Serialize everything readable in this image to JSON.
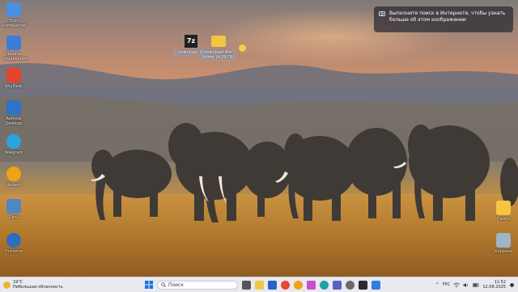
{
  "desktop": {
    "left_icons": [
      {
        "label": "Этот компьютер",
        "icon": "monitor-icon",
        "color": "#4a8fe0"
      },
      {
        "label": "Панель управления",
        "icon": "control-panel-icon",
        "color": "#3b7dd8"
      },
      {
        "label": "AnyDesk",
        "icon": "anydesk-icon",
        "color": "#e5432b"
      },
      {
        "label": "Remote Desktop",
        "icon": "remote-desktop-icon",
        "color": "#2c73c9"
      },
      {
        "label": "Telegram",
        "icon": "telegram-icon",
        "color": "#2aa3e0"
      },
      {
        "label": "Яндекс",
        "icon": "yandex-icon",
        "color": "#f0a219"
      },
      {
        "label": "Сеть",
        "icon": "network-icon",
        "color": "#4f86c6"
      },
      {
        "label": "Утилита",
        "icon": "utility-icon",
        "color": "#2d6cc0"
      }
    ],
    "right_icons": [
      {
        "label": "Папка",
        "icon": "folder-icon",
        "color": "#f3c543"
      },
      {
        "label": "Корзина",
        "icon": "recycle-bin-icon",
        "color": "#9fb4c8"
      }
    ],
    "center_icons": [
      {
        "label": "download.7z",
        "icon": "7zip-icon",
        "color": "#222222"
      },
      {
        "label": "download-file-folder (4.09 ГБ)",
        "icon": "folder-icon",
        "color": "#f3c543"
      }
    ]
  },
  "notification": {
    "text": "Выполните поиск в Интернете, чтобы узнать больше об этом изображении"
  },
  "taskbar": {
    "weather_temp": "19°C",
    "weather_desc": "Небольшая облачность",
    "search_placeholder": "Поиск",
    "language": "РУС",
    "time": "11:52",
    "date": "12.08.2025",
    "pinned": [
      {
        "icon": "windows-start-icon",
        "color": "#1a73e8"
      },
      {
        "icon": "task-view-icon",
        "color": "#555555"
      },
      {
        "icon": "file-explorer-icon",
        "color": "#f3c543"
      },
      {
        "icon": "store-icon",
        "color": "#2b63c4"
      },
      {
        "icon": "chrome-icon",
        "color": "#e9453a"
      },
      {
        "icon": "yandex-browser-icon",
        "color": "#f0a219"
      },
      {
        "icon": "photos-icon",
        "color": "#c94fcf"
      },
      {
        "icon": "edge-icon",
        "color": "#1fa0a7"
      },
      {
        "icon": "teams-icon",
        "color": "#5a5fc7"
      },
      {
        "icon": "settings-icon",
        "color": "#6b6b6b"
      },
      {
        "icon": "terminal-icon",
        "color": "#2a2a2a"
      },
      {
        "icon": "mail-icon",
        "color": "#2f7fe0"
      }
    ]
  }
}
